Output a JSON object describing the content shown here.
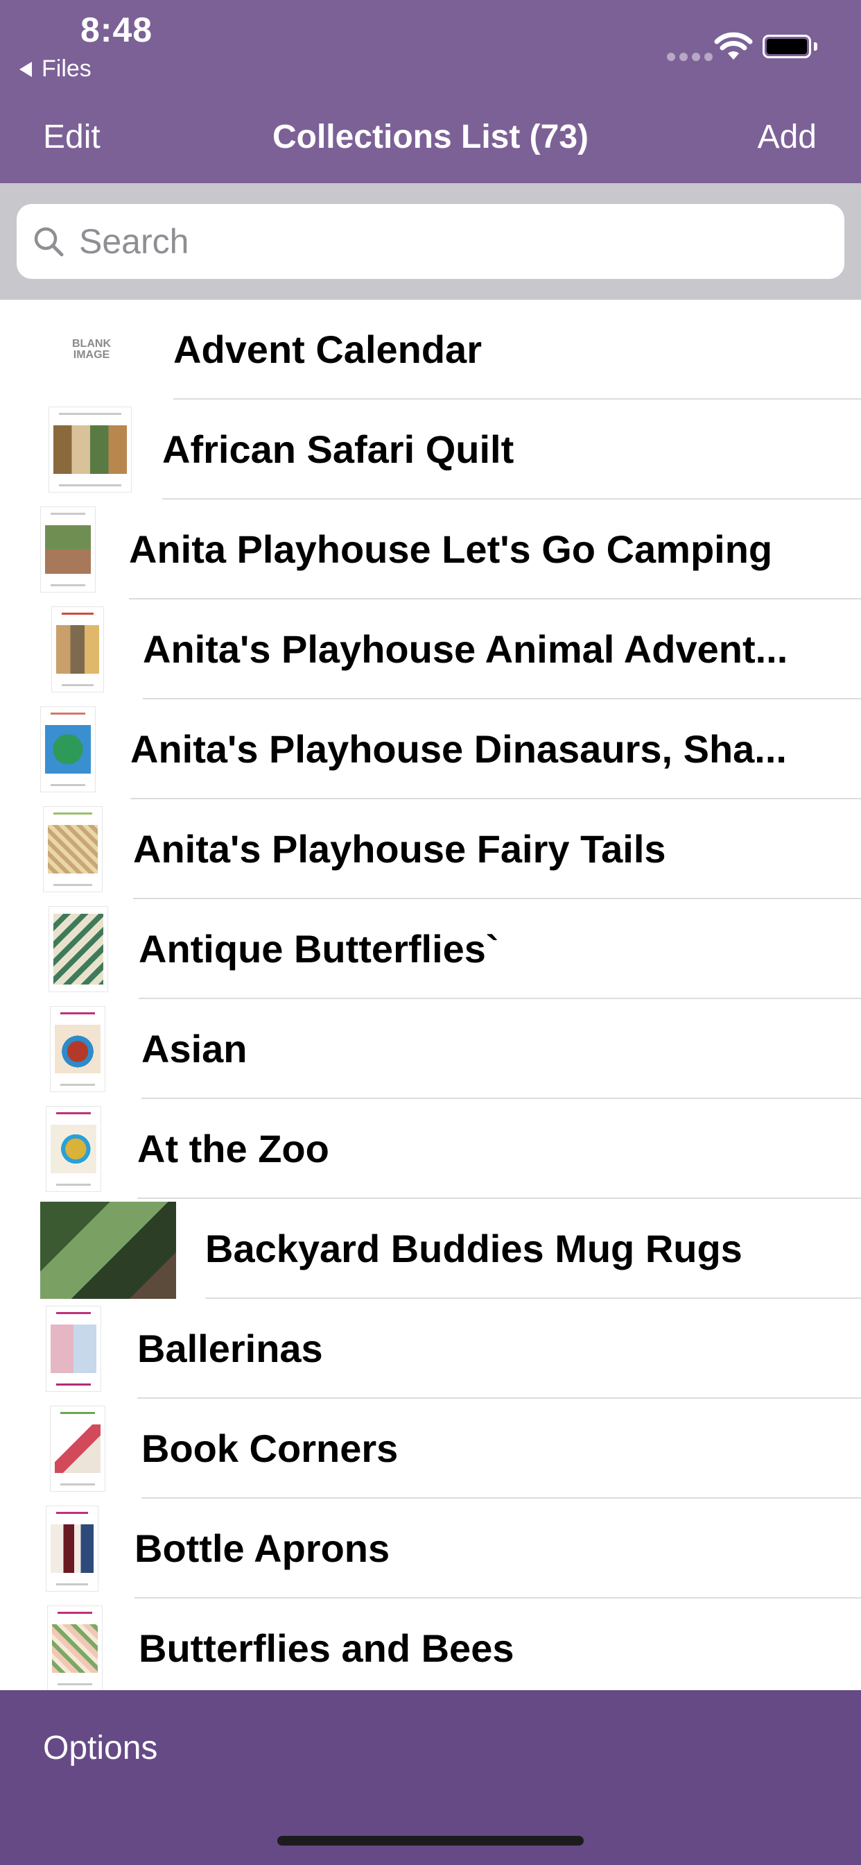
{
  "status_bar": {
    "time": "8:48",
    "back_app": "Files",
    "icons": [
      "cellular-signal-icon",
      "wifi-icon",
      "battery-icon"
    ]
  },
  "nav": {
    "edit_label": "Edit",
    "title": "Collections List (73)",
    "add_label": "Add"
  },
  "search": {
    "placeholder": "Search",
    "value": ""
  },
  "collections": [
    {
      "label": "Advent Calendar",
      "thumb": "BLANK IMAGE"
    },
    {
      "label": "African Safari Quilt"
    },
    {
      "label": "Anita Playhouse Let's Go Camping"
    },
    {
      "label": "Anita's Playhouse Animal Advent..."
    },
    {
      "label": "Anita's Playhouse Dinasaurs, Sha..."
    },
    {
      "label": "Anita's Playhouse Fairy Tails"
    },
    {
      "label": "Antique Butterflies`"
    },
    {
      "label": "Asian"
    },
    {
      "label": "At the Zoo"
    },
    {
      "label": "Backyard Buddies Mug Rugs"
    },
    {
      "label": "Ballerinas"
    },
    {
      "label": "Book Corners"
    },
    {
      "label": "Bottle Aprons"
    },
    {
      "label": "Butterflies and Bees"
    }
  ],
  "toolbar": {
    "options_label": "Options"
  },
  "colors": {
    "nav_bar": "#7c6196",
    "toolbar": "#664a86",
    "search_area": "#c8c7cc"
  }
}
